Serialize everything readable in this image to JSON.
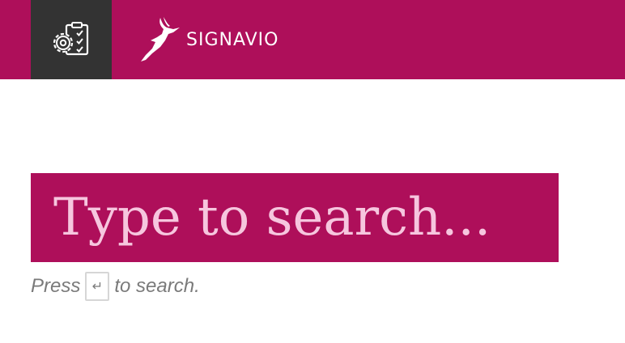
{
  "header": {
    "app_switcher_icon": "settings-checklist-icon",
    "logo_icon": "antelope-logo-icon",
    "logo_text": "SIGNAVIO",
    "background_color": "#ae0f5a",
    "switcher_color": "#333333"
  },
  "search": {
    "placeholder": "Type to search...",
    "value": ""
  },
  "hint": {
    "prefix": "Press",
    "key_glyph": "↵",
    "suffix": "to search."
  }
}
